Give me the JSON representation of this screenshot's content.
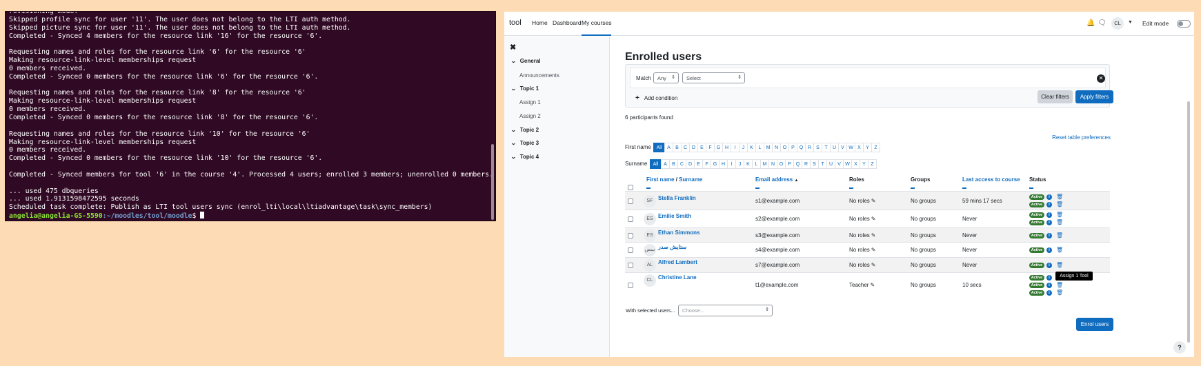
{
  "terminal": {
    "lines": [
      "rovisioning mode.",
      "Skipped profile sync for user '11'. The user does not belong to the LTI auth method.",
      "Skipped picture sync for user '11'. The user does not belong to the LTI auth method.",
      "Completed - Synced 4 members for the resource link '16' for the resource '6'.",
      "",
      "Requesting names and roles for the resource link '6' for the resource '6'",
      "Making resource-link-level memberships request",
      "0 members received.",
      "Completed - Synced 0 members for the resource link '6' for the resource '6'.",
      "",
      "Requesting names and roles for the resource link '8' for the resource '6'",
      "Making resource-link-level memberships request",
      "0 members received.",
      "Completed - Synced 0 members for the resource link '8' for the resource '6'.",
      "",
      "Requesting names and roles for the resource link '10' for the resource '6'",
      "Making resource-link-level memberships request",
      "0 members received.",
      "Completed - Synced 0 members for the resource link '10' for the resource '6'.",
      "",
      "Completed - Synced members for tool '6' in the course '4'. Processed 4 users; enrolled 3 members; unenrolled 0 members.",
      "",
      "... used 475 dbqueries",
      "... used 1.9131598472595 seconds",
      "Scheduled task complete: Publish as LTI tool users sync (enrol_lti\\local\\ltiadvantage\\task\\sync_members)"
    ],
    "prompt_user": "angelia@angelia-GS-5590",
    "prompt_path": ":~/moodles/tool/moodle",
    "prompt_symbol": "$ "
  },
  "navbar": {
    "brand": "tool",
    "links": [
      "Home",
      "Dashboard",
      "My courses"
    ],
    "avatar_initials": "CL",
    "edit_mode": "Edit mode"
  },
  "drawer": {
    "close": "✖",
    "sections": [
      {
        "label": "General",
        "activities": [
          "Announcements"
        ]
      },
      {
        "label": "Topic 1",
        "activities": [
          "Assign 1",
          "Assign 2"
        ]
      },
      {
        "label": "Topic 2",
        "activities": []
      },
      {
        "label": "Topic 3",
        "activities": []
      },
      {
        "label": "Topic 4",
        "activities": []
      }
    ]
  },
  "main": {
    "title": "Enrolled users",
    "filter": {
      "match_label": "Match",
      "match_value": "Any",
      "select_value": "Select",
      "add_condition": "Add condition",
      "clear_filters": "Clear filters",
      "apply_filters": "Apply filters"
    },
    "participants_found": "6 participants found",
    "reset_prefs": "Reset table preferences",
    "first_name_label": "First name",
    "surname_label": "Surname",
    "letters": [
      "All",
      "A",
      "B",
      "C",
      "D",
      "E",
      "F",
      "G",
      "H",
      "I",
      "J",
      "K",
      "L",
      "M",
      "N",
      "O",
      "P",
      "Q",
      "R",
      "S",
      "T",
      "U",
      "V",
      "W",
      "X",
      "Y",
      "Z"
    ],
    "columns": {
      "first_name": "First name",
      "slash": " / ",
      "surname": "Surname",
      "email": "Email address",
      "roles": "Roles",
      "groups": "Groups",
      "last_access": "Last access to course",
      "status": "Status"
    },
    "rows": [
      {
        "initials": "SF",
        "name": "Stella Franklin",
        "email": "s1@example.com",
        "roles": "No roles",
        "groups": "No groups",
        "last_access": "59 mins 17 secs",
        "statuses": [
          "Active",
          "Active"
        ]
      },
      {
        "initials": "ES",
        "name": "Emilie Smith",
        "email": "s2@example.com",
        "roles": "No roles",
        "groups": "No groups",
        "last_access": "Never",
        "statuses": [
          "Active",
          "Active"
        ]
      },
      {
        "initials": "ES",
        "name": "Ethan Simmons",
        "email": "s3@example.com",
        "roles": "No roles",
        "groups": "No groups",
        "last_access": "Never",
        "statuses": [
          "Active"
        ]
      },
      {
        "initials": "سص",
        "name": "ستايش صدر",
        "email": "s4@example.com",
        "roles": "No roles",
        "groups": "No groups",
        "last_access": "Never",
        "statuses": [
          "Active"
        ]
      },
      {
        "initials": "AL",
        "name": "Alfred Lambert",
        "email": "s7@example.com",
        "roles": "No roles",
        "groups": "No groups",
        "last_access": "Never",
        "statuses": [
          "Active"
        ]
      },
      {
        "initials": "CL",
        "name": "Christine Lane",
        "email": "t1@example.com",
        "roles": "Teacher",
        "groups": "No groups",
        "last_access": "10 secs",
        "statuses": [
          "Active",
          "Active",
          "Active"
        ]
      }
    ],
    "tooltip": "Assign 1 Tool",
    "with_selected": "With selected users...",
    "choose": "Choose...",
    "enrol_users": "Enrol users",
    "help": "?"
  }
}
